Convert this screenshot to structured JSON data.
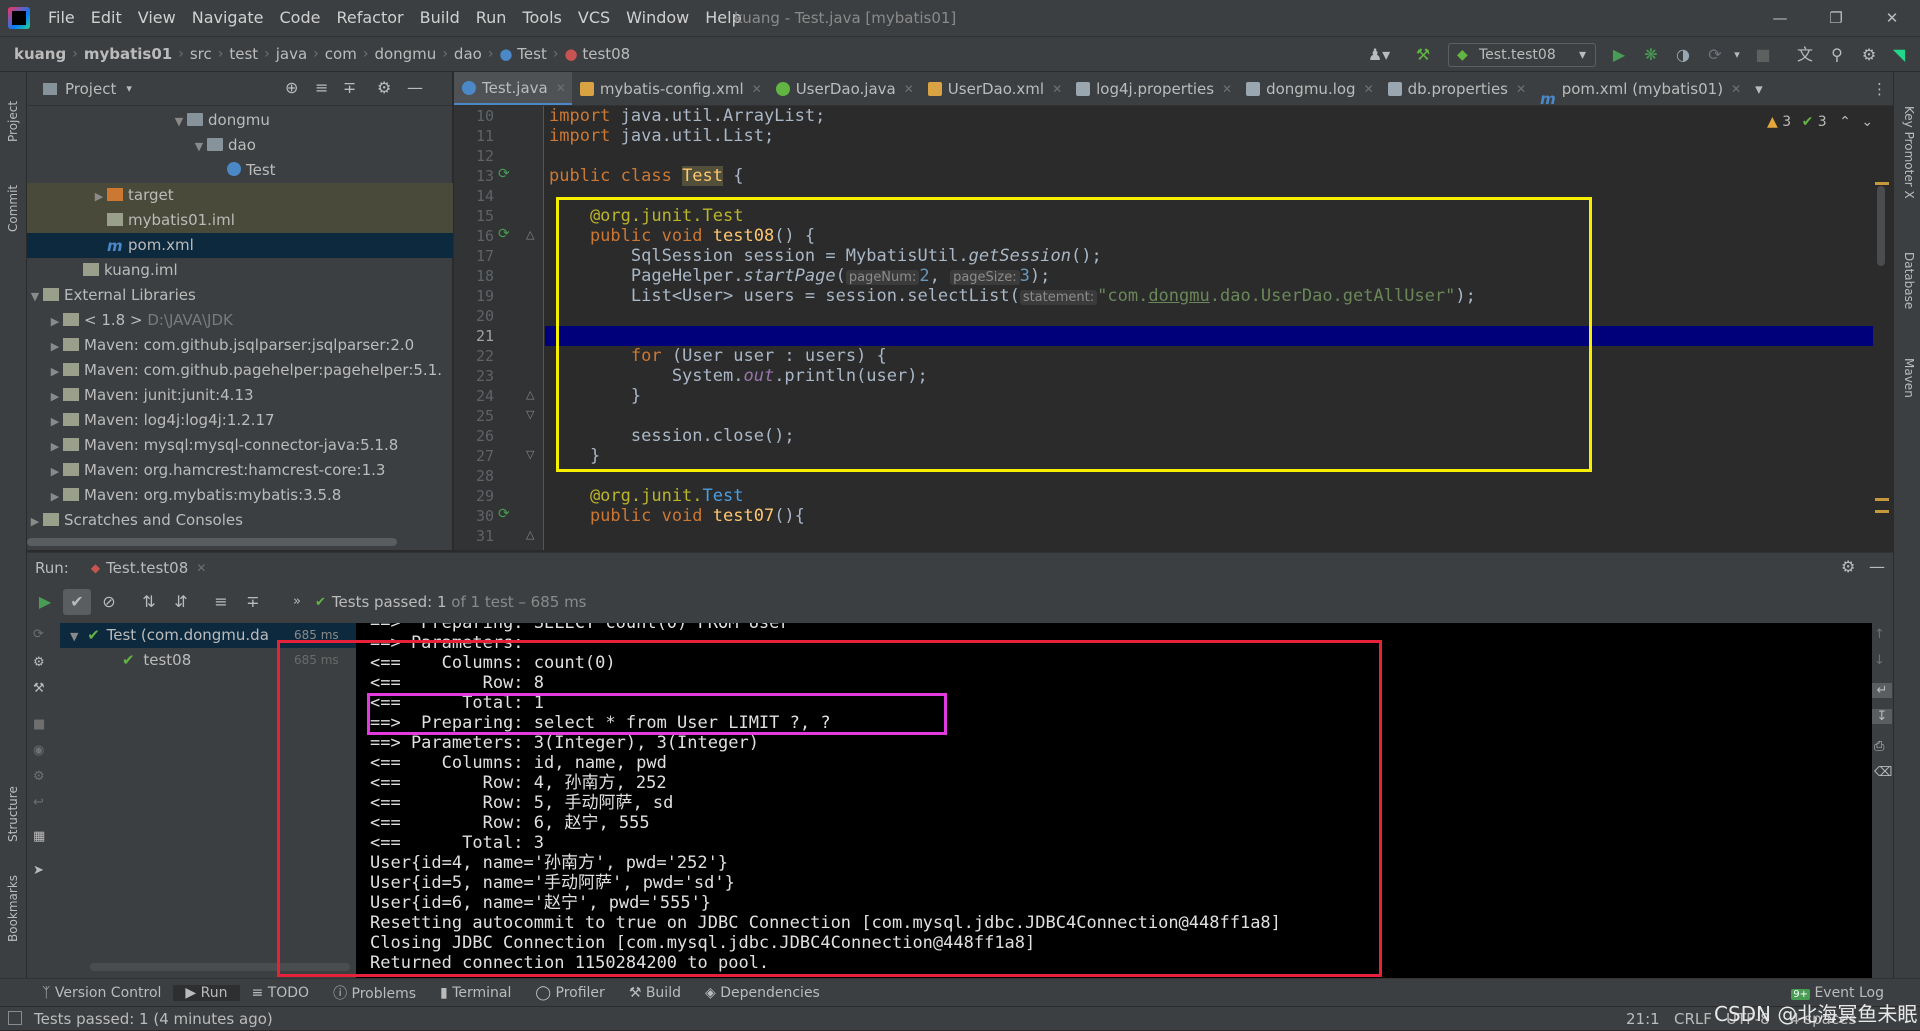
{
  "menu": [
    "File",
    "Edit",
    "View",
    "Navigate",
    "Code",
    "Refactor",
    "Build",
    "Run",
    "Tools",
    "VCS",
    "Window",
    "Help"
  ],
  "window_title": "kuang - Test.java [mybatis01]",
  "breadcrumb": [
    "kuang",
    "mybatis01",
    "src",
    "test",
    "java",
    "com",
    "dongmu",
    "dao",
    "Test",
    "test08"
  ],
  "run_config": "Test.test08",
  "project": {
    "title": "Project",
    "tree": [
      {
        "label": "dongmu",
        "depth": 7
      },
      {
        "label": "dao",
        "depth": 8
      },
      {
        "label": "Test",
        "depth": 9
      },
      {
        "label": "target",
        "depth": 3
      },
      {
        "label": "mybatis01.iml",
        "depth": 3
      },
      {
        "label": "pom.xml",
        "depth": 3
      },
      {
        "label": "kuang.iml",
        "depth": 2
      },
      {
        "label": "External Libraries",
        "depth": 0
      },
      {
        "label": "< 1.8 >",
        "note": "D:\\JAVA\\JDK",
        "depth": 1
      },
      {
        "label": "Maven: com.github.jsqlparser:jsqlparser:2.0",
        "depth": 1
      },
      {
        "label": "Maven: com.github.pagehelper:pagehelper:5.1.",
        "depth": 1
      },
      {
        "label": "Maven: junit:junit:4.13",
        "depth": 1
      },
      {
        "label": "Maven: log4j:log4j:1.2.17",
        "depth": 1
      },
      {
        "label": "Maven: mysql:mysql-connector-java:5.1.8",
        "depth": 1
      },
      {
        "label": "Maven: org.hamcrest:hamcrest-core:1.3",
        "depth": 1
      },
      {
        "label": "Maven: org.mybatis:mybatis:3.5.8",
        "depth": 1
      },
      {
        "label": "Scratches and Consoles",
        "depth": 0
      }
    ]
  },
  "editor_tabs": [
    {
      "label": "Test.java",
      "color": "#4a88c7"
    },
    {
      "label": "mybatis-config.xml",
      "color": "#d9a343"
    },
    {
      "label": "UserDao.java",
      "color": "#62b543"
    },
    {
      "label": "UserDao.xml",
      "color": "#d9a343"
    },
    {
      "label": "log4j.properties",
      "color": "#9aa7b0"
    },
    {
      "label": "dongmu.log",
      "color": "#9aa7b0"
    },
    {
      "label": "db.properties",
      "color": "#9aa7b0"
    },
    {
      "label": "pom.xml (mybatis01)",
      "color": "#4a88c7"
    }
  ],
  "inspections": {
    "warnings": "3",
    "ok": "3"
  },
  "line_numbers": [
    "10",
    "11",
    "12",
    "13",
    "14",
    "15",
    "16",
    "17",
    "18",
    "19",
    "20",
    "21",
    "22",
    "23",
    "24",
    "25",
    "26",
    "27",
    "28",
    "29",
    "30",
    "31"
  ],
  "code": {
    "l10": [
      "import",
      " java.util.ArrayList;"
    ],
    "l11": [
      "import",
      " java.util.List;"
    ],
    "l13": [
      "public class ",
      "Test",
      " {"
    ],
    "l15": [
      "    @org.junit.",
      "Test"
    ],
    "l16": [
      "    public void ",
      "test08",
      "() {"
    ],
    "l17": [
      "        SqlSession session = MybatisUtil.",
      "getSession",
      "();"
    ],
    "l18": [
      "        PageHelper.",
      "startPage",
      "(",
      "pageNum:",
      "2",
      ", ",
      "pageSize:",
      "3",
      ");"
    ],
    "l19": [
      "        List<User> users = session.selectList(",
      "statement:",
      "\"com.",
      "dongmu",
      ".dao.UserDao.getAllUser\"",
      ");"
    ],
    "l22": [
      "        ",
      "for",
      " (User user : users) {"
    ],
    "l23": [
      "            System.",
      "out",
      ".println(user);"
    ],
    "l24": [
      "        }"
    ],
    "l26": [
      "        session.close();"
    ],
    "l27": [
      "    }"
    ],
    "l29": [
      "    @org.junit.",
      "Test"
    ],
    "l30": [
      "    public void ",
      "test07",
      "(){"
    ]
  },
  "run": {
    "label": "Run:",
    "tab": "Test.test08",
    "status_prefix": "Tests passed:",
    "status_count": "1",
    "status_suffix": "of 1 test – 685 ms",
    "tree": [
      {
        "label": "Test (com.dongmu.da",
        "time": "685 ms"
      },
      {
        "label": "test08",
        "time": "685 ms"
      }
    ]
  },
  "console": [
    "==>  Preparing: SELECT count(0) FROM User",
    "==> Parameters: ",
    "<==    Columns: count(0)",
    "<==        Row: 8",
    "<==      Total: 1",
    "==>  Preparing: select * from User LIMIT ?, ?",
    "==> Parameters: 3(Integer), 3(Integer)",
    "<==    Columns: id, name, pwd",
    "<==        Row: 4, 孙南方, 252",
    "<==        Row: 5, 手动阿萨, sd",
    "<==        Row: 6, 赵宁, 555",
    "<==      Total: 3",
    "User{id=4, name='孙南方', pwd='252'}",
    "User{id=5, name='手动阿萨', pwd='sd'}",
    "User{id=6, name='赵宁', pwd='555'}",
    "Resetting autocommit to true on JDBC Connection [com.mysql.jdbc.JDBC4Connection@448ff1a8]",
    "Closing JDBC Connection [com.mysql.jdbc.JDBC4Connection@448ff1a8]",
    "Returned connection 1150284200 to pool."
  ],
  "left_stripe": [
    "Project",
    "Commit",
    "Structure",
    "Bookmarks"
  ],
  "right_stripe": [
    "Key Promoter X",
    "Database",
    "Maven"
  ],
  "bottom_tabs": [
    "Version Control",
    "Run",
    "TODO",
    "Problems",
    "Terminal",
    "Profiler",
    "Build",
    "Dependencies"
  ],
  "event_log": {
    "badge": "9+",
    "label": "Event Log"
  },
  "status": {
    "message": "Tests passed: 1 (4 minutes ago)",
    "position": "21:1",
    "line_sep": "CRLF",
    "encoding": "UTF-8",
    "indent": "4 spaces"
  },
  "watermark": "CSDN @北海冥鱼未眠"
}
